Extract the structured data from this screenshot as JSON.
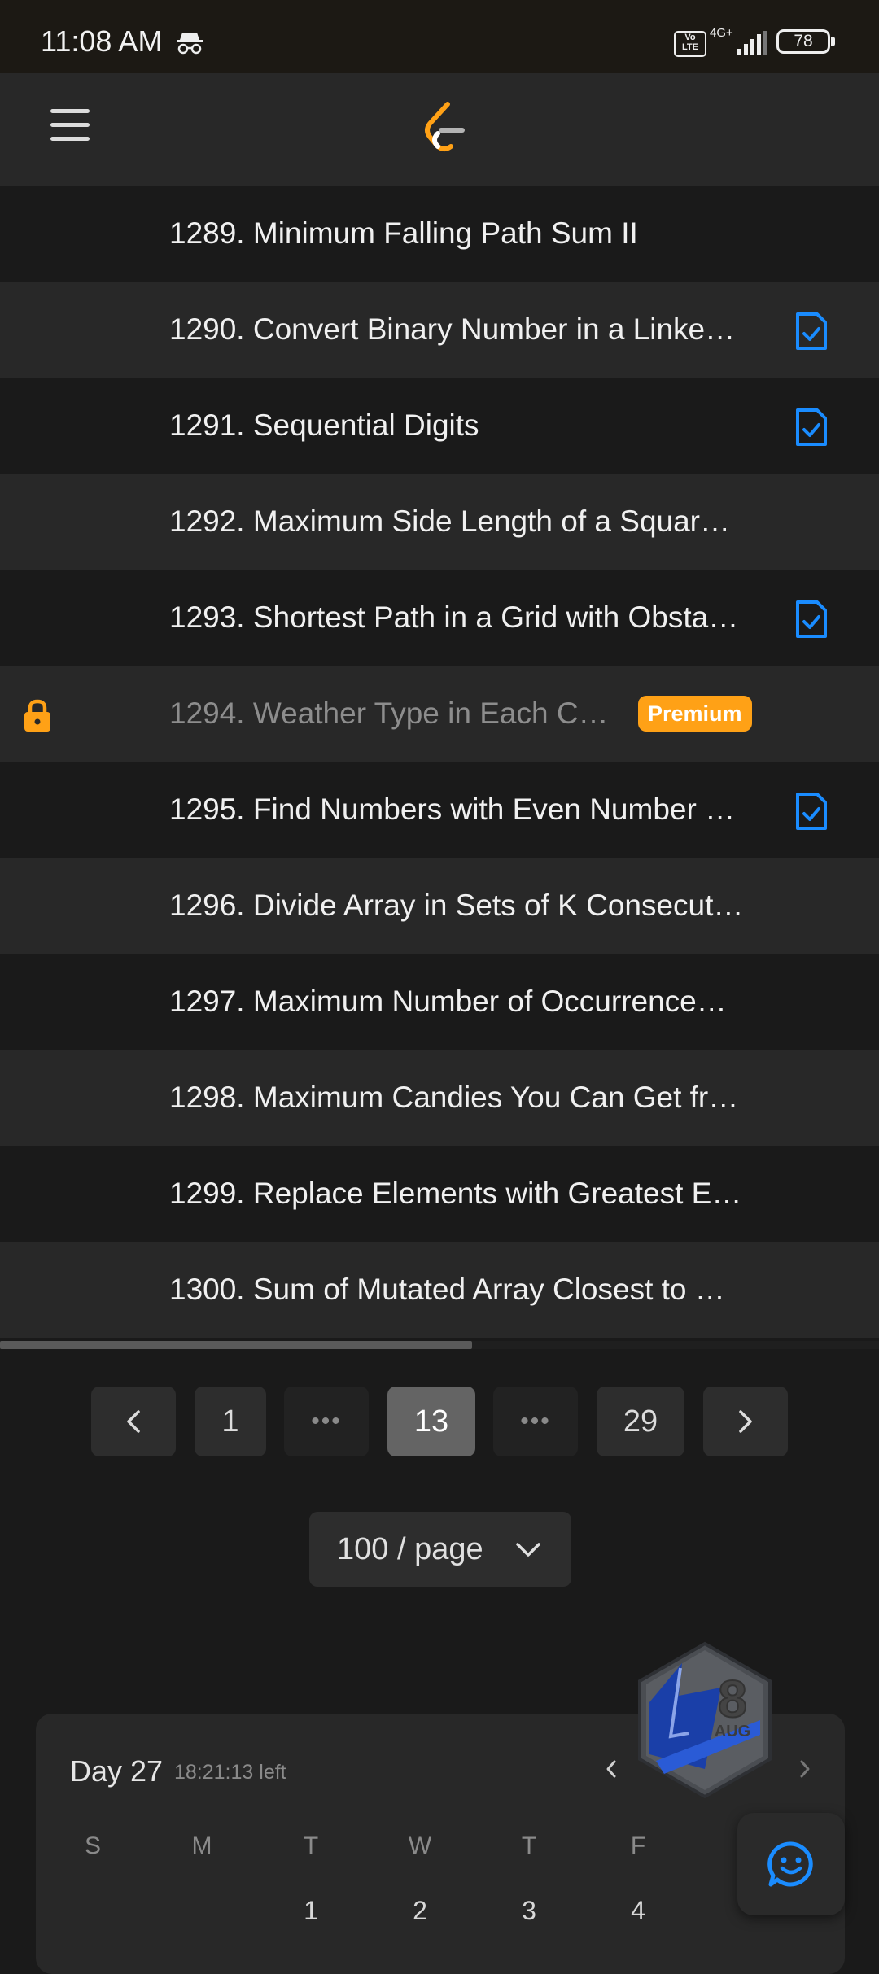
{
  "status_bar": {
    "time": "11:08 AM",
    "network": "4G+",
    "volte": "Vo LTE",
    "battery": "78"
  },
  "header": {
    "menu_icon": "hamburger-menu-icon",
    "logo": "leetcode-logo"
  },
  "problems": [
    {
      "title": "1289. Minimum Falling Path Sum II",
      "solved": false,
      "premium": false
    },
    {
      "title": "1290. Convert Binary Number in a Linke…",
      "solved": true,
      "premium": false
    },
    {
      "title": "1291. Sequential Digits",
      "solved": true,
      "premium": false
    },
    {
      "title": "1292. Maximum Side Length of a Squar…",
      "solved": false,
      "premium": false
    },
    {
      "title": "1293. Shortest Path in a Grid with Obsta…",
      "solved": true,
      "premium": false
    },
    {
      "title": "1294. Weather Type in Each C…",
      "solved": false,
      "premium": true
    },
    {
      "title": "1295. Find Numbers with Even Number …",
      "solved": true,
      "premium": false
    },
    {
      "title": "1296. Divide Array in Sets of K Consecut…",
      "solved": false,
      "premium": false
    },
    {
      "title": "1297. Maximum Number of Occurrence…",
      "solved": false,
      "premium": false
    },
    {
      "title": "1298. Maximum Candies You Can Get fr…",
      "solved": false,
      "premium": false
    },
    {
      "title": "1299. Replace Elements with Greatest E…",
      "solved": false,
      "premium": false
    },
    {
      "title": "1300. Sum of Mutated Array Closest to …",
      "solved": false,
      "premium": false
    }
  ],
  "premium_label": "Premium",
  "pagination": {
    "prev_icon": "chevron-left-icon",
    "pages": [
      "1",
      "•••",
      "13",
      "•••",
      "29"
    ],
    "current": "13",
    "next_icon": "chevron-right-icon"
  },
  "page_size": {
    "label": "100 / page"
  },
  "calendar": {
    "day_label": "Day 27",
    "time_left": "18:21:13 left",
    "weekdays": [
      "S",
      "M",
      "T",
      "W",
      "T",
      "F"
    ],
    "dates": [
      "1",
      "2",
      "3",
      "4"
    ]
  },
  "badge": {
    "day": "8",
    "month": "AUG"
  },
  "colors": {
    "accent": "#ffa116",
    "solved_blue": "#1a8cff",
    "background": "#1a1a1a",
    "row_alt": "#282828"
  }
}
